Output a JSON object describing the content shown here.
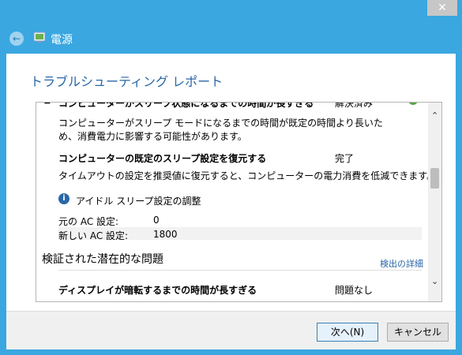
{
  "window": {
    "close_glyph": "✕"
  },
  "header": {
    "back_glyph": "←",
    "title": "電源"
  },
  "page_title": "トラブルシューティング レポート",
  "report": {
    "top_row": {
      "bullet": "▲",
      "name": "コンピューターがスリープ状態になるまでの時間が長すぎる",
      "status": "解決済み",
      "check_glyph": "✓"
    },
    "top_desc": "コンピューターがスリープ モードになるまでの時間が既定の時間より長いため、消費電力に影響する可能性があります。",
    "fix": {
      "name": "コンピューターの既定のスリープ設定を復元する",
      "status": "完了",
      "desc": "タイムアウトの設定を推奨値に復元すると、コンピューターの電力消費を低減できます。"
    },
    "info": {
      "glyph": "i",
      "label": "アイドル スリープ設定の調整"
    },
    "settings": {
      "orig_label": "元の AC 設定:",
      "orig_value": "0",
      "new_label": "新しい AC 設定:",
      "new_value": "1800"
    },
    "section_title": "検証された潜在的な問題",
    "detect_link": "検出の詳細",
    "bottom_row": {
      "name": "ディスプレイが暗転するまでの時間が長すぎる",
      "status": "問題なし"
    },
    "scroll_up": "⌃",
    "scroll_down": "⌄"
  },
  "footer": {
    "next": "次へ(N)",
    "cancel": "キャンセル"
  },
  "colors": {
    "accent": "#3aa7e0",
    "link": "#2a67a8",
    "success": "#5aa546"
  }
}
